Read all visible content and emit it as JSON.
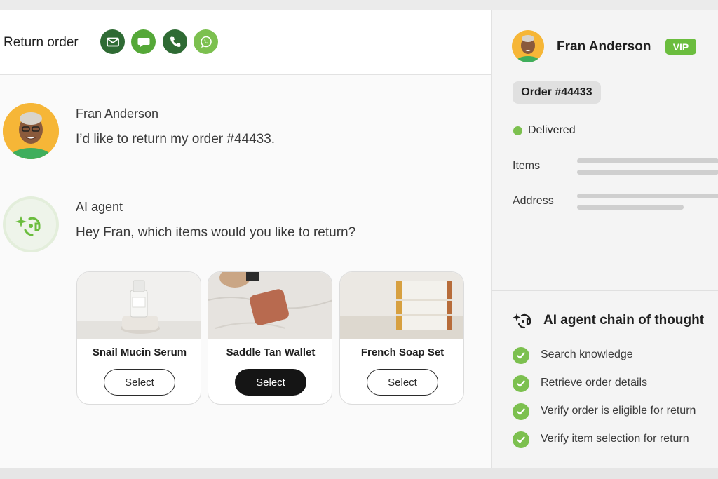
{
  "header": {
    "title": "Return order",
    "channels": [
      {
        "icon": "envelope-icon",
        "color": "#2f6b34"
      },
      {
        "icon": "chat-bubble-icon",
        "color": "#55a838"
      },
      {
        "icon": "phone-icon",
        "color": "#2f6b34"
      },
      {
        "icon": "whatsapp-icon",
        "color": "#7cc04f"
      }
    ]
  },
  "conversation": {
    "customer": {
      "name": "Fran Anderson",
      "message": "I’d like to return my order #44433."
    },
    "agent": {
      "name": "AI agent",
      "message": "Hey Fran, which items would you like to return?"
    },
    "products": [
      {
        "name": "Snail Mucin Serum",
        "button": "Select",
        "selected": false
      },
      {
        "name": "Saddle Tan Wallet",
        "button": "Select",
        "selected": true
      },
      {
        "name": "French Soap Set",
        "button": "Select",
        "selected": false
      }
    ]
  },
  "sidebar": {
    "customer_name": "Fran Anderson",
    "badge": "VIP",
    "order": "Order #44433",
    "status": "Delivered",
    "fields": {
      "items_label": "Items",
      "address_label": "Address"
    },
    "chain_of_thought": {
      "title": "AI agent chain of thought",
      "steps": [
        "Search knowledge",
        "Retrieve order details",
        "Verify order is eligible for return",
        "Verify item selection for return"
      ]
    }
  },
  "colors": {
    "accent_green": "#7cc04f",
    "dark_green": "#2f6b34",
    "vip_green": "#6bbd3e"
  }
}
